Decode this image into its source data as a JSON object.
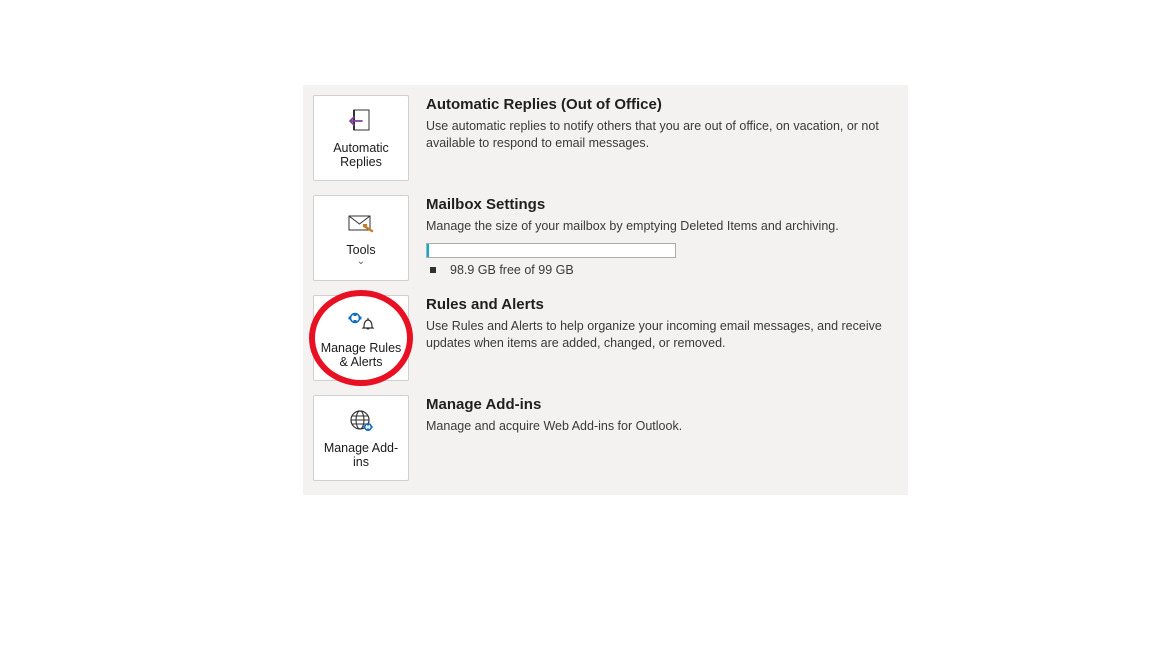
{
  "sections": {
    "autoReplies": {
      "tileLabel": "Automatic Replies",
      "title": "Automatic Replies (Out of Office)",
      "desc": "Use automatic replies to notify others that you are out of office, on vacation, or not available to respond to email messages."
    },
    "mailboxSettings": {
      "tileLabel": "Tools",
      "title": "Mailbox Settings",
      "desc": "Manage the size of your mailbox by emptying Deleted Items and archiving.",
      "status": "98.9 GB free of 99 GB"
    },
    "rulesAlerts": {
      "tileLabel": "Manage Rules & Alerts",
      "title": "Rules and Alerts",
      "desc": "Use Rules and Alerts to help organize your incoming email messages, and receive updates when items are added, changed, or removed."
    },
    "addIns": {
      "tileLabel": "Manage Add-ins",
      "title": "Manage Add-ins",
      "desc": "Manage and acquire Web Add-ins for Outlook."
    }
  }
}
